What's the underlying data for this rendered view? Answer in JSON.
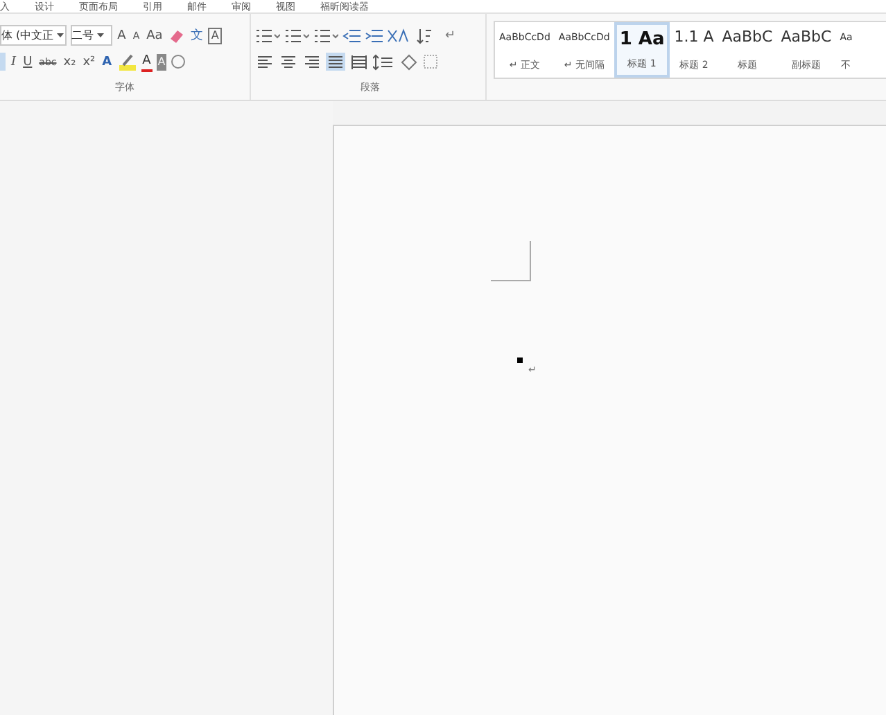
{
  "tabs": [
    {
      "label": "入",
      "selected": false
    },
    {
      "label": "设计",
      "selected": false
    },
    {
      "label": "页面布局",
      "selected": false
    },
    {
      "label": "引用",
      "selected": false
    },
    {
      "label": "邮件",
      "selected": false
    },
    {
      "label": "审阅",
      "selected": false
    },
    {
      "label": "视图",
      "selected": false
    },
    {
      "label": "福昕阅读器",
      "selected": false
    }
  ],
  "font_group": {
    "font_name": "体 (中文正",
    "font_size": "二号",
    "grow": "A",
    "shrink": "A",
    "case": "Aa",
    "phonetic": "文",
    "border": "A",
    "italic": "I",
    "underline": "U",
    "strike": "abc",
    "subscript": "x₂",
    "superscript": "x²",
    "effect": "A",
    "font_color_label": "A",
    "shade": "A",
    "label": "字体",
    "bold_on": true
  },
  "paragraph_group": {
    "label": "段落",
    "align": [
      {
        "kind": "left",
        "selected": false
      },
      {
        "kind": "center",
        "selected": false
      },
      {
        "kind": "right",
        "selected": false
      },
      {
        "kind": "justify",
        "selected": true
      },
      {
        "kind": "distributed",
        "selected": false
      }
    ]
  },
  "styles": [
    {
      "sample": "AaBbCcDd",
      "name": "↵ 正文",
      "kind": "small",
      "selected": false
    },
    {
      "sample": "AaBbCcDd",
      "name": "↵ 无间隔",
      "kind": "small",
      "selected": false
    },
    {
      "sample": "1  Aa",
      "name": "标题 1",
      "kind": "h1",
      "selected": true
    },
    {
      "sample": "1.1  A",
      "name": "标题 2",
      "kind": "h2",
      "selected": false
    },
    {
      "sample": "AaBbC",
      "name": "标题",
      "kind": "large",
      "selected": false
    },
    {
      "sample": "AaBbC",
      "name": "副标题",
      "kind": "large",
      "selected": false
    },
    {
      "sample": "Aa",
      "name": "不",
      "kind": "small",
      "selected": false
    }
  ],
  "document": {
    "paragraph_mark": "↵"
  }
}
